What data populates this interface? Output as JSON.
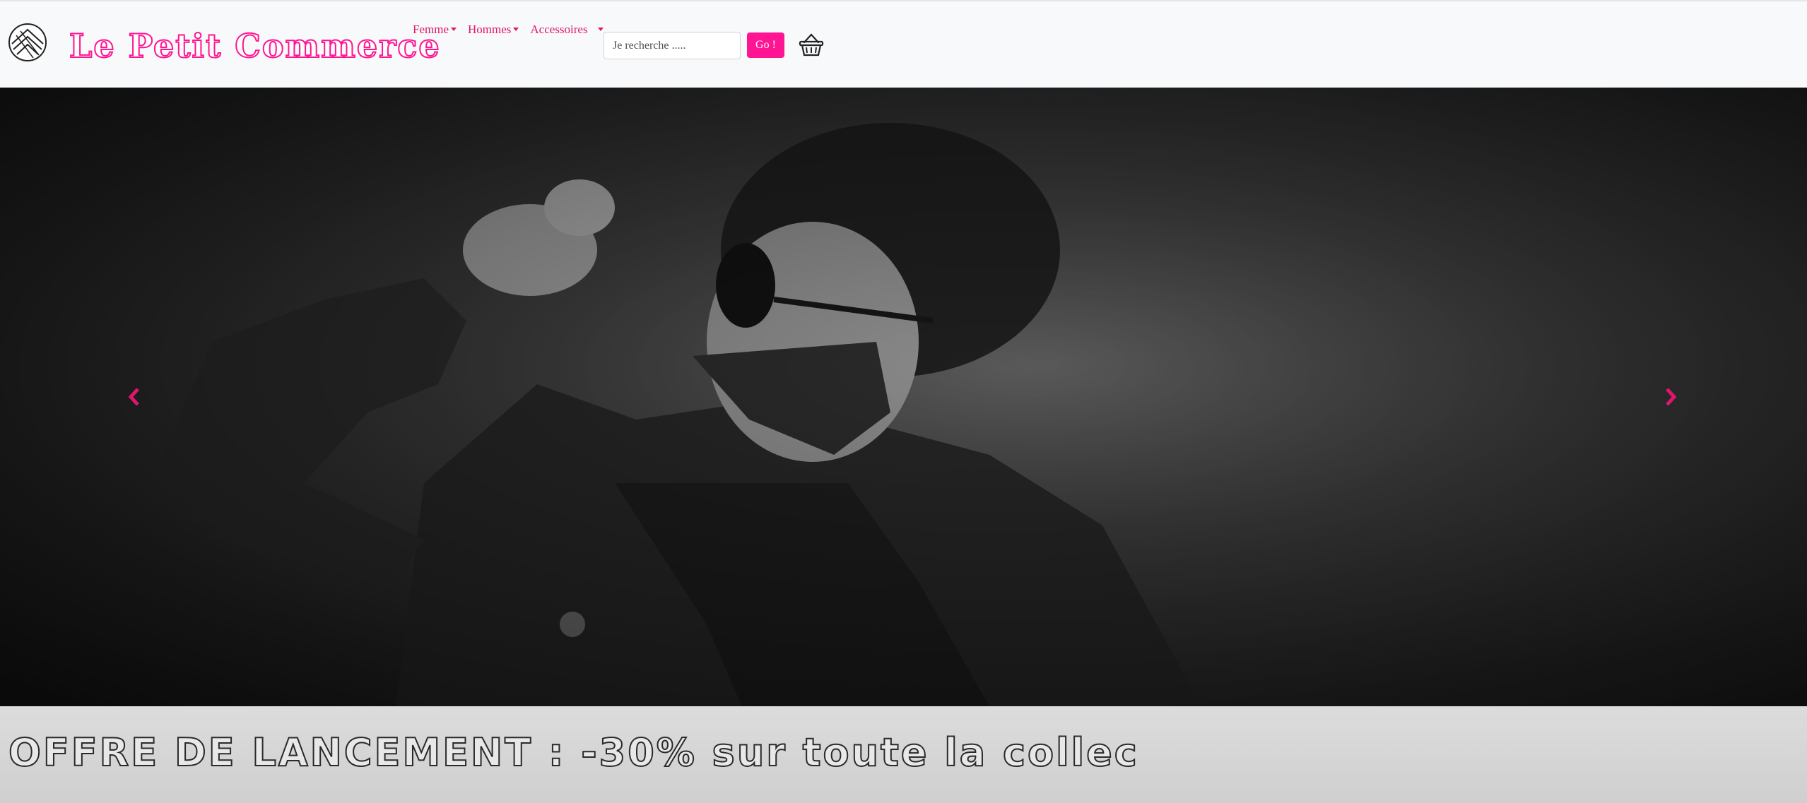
{
  "header": {
    "logo_icon": "chevron-stripes-logo-icon",
    "brand": "Le Petit Commerce",
    "brand_color": "#ff1493",
    "nav": [
      {
        "label": "Femme"
      },
      {
        "label": "Hommes"
      },
      {
        "label": "Accessoires"
      }
    ],
    "search": {
      "placeholder": "Je recherche .....",
      "value": ""
    },
    "go_label": "Go !",
    "basket_icon": "shopping-basket-icon"
  },
  "carousel": {
    "image_description_icon": "hero-photo",
    "prev_icon": "chevron-left-icon",
    "next_icon": "chevron-right-icon",
    "control_color": "#e0156f"
  },
  "promo": {
    "text": "OFFRE DE LANCEMENT : -30% sur toute la collec"
  }
}
